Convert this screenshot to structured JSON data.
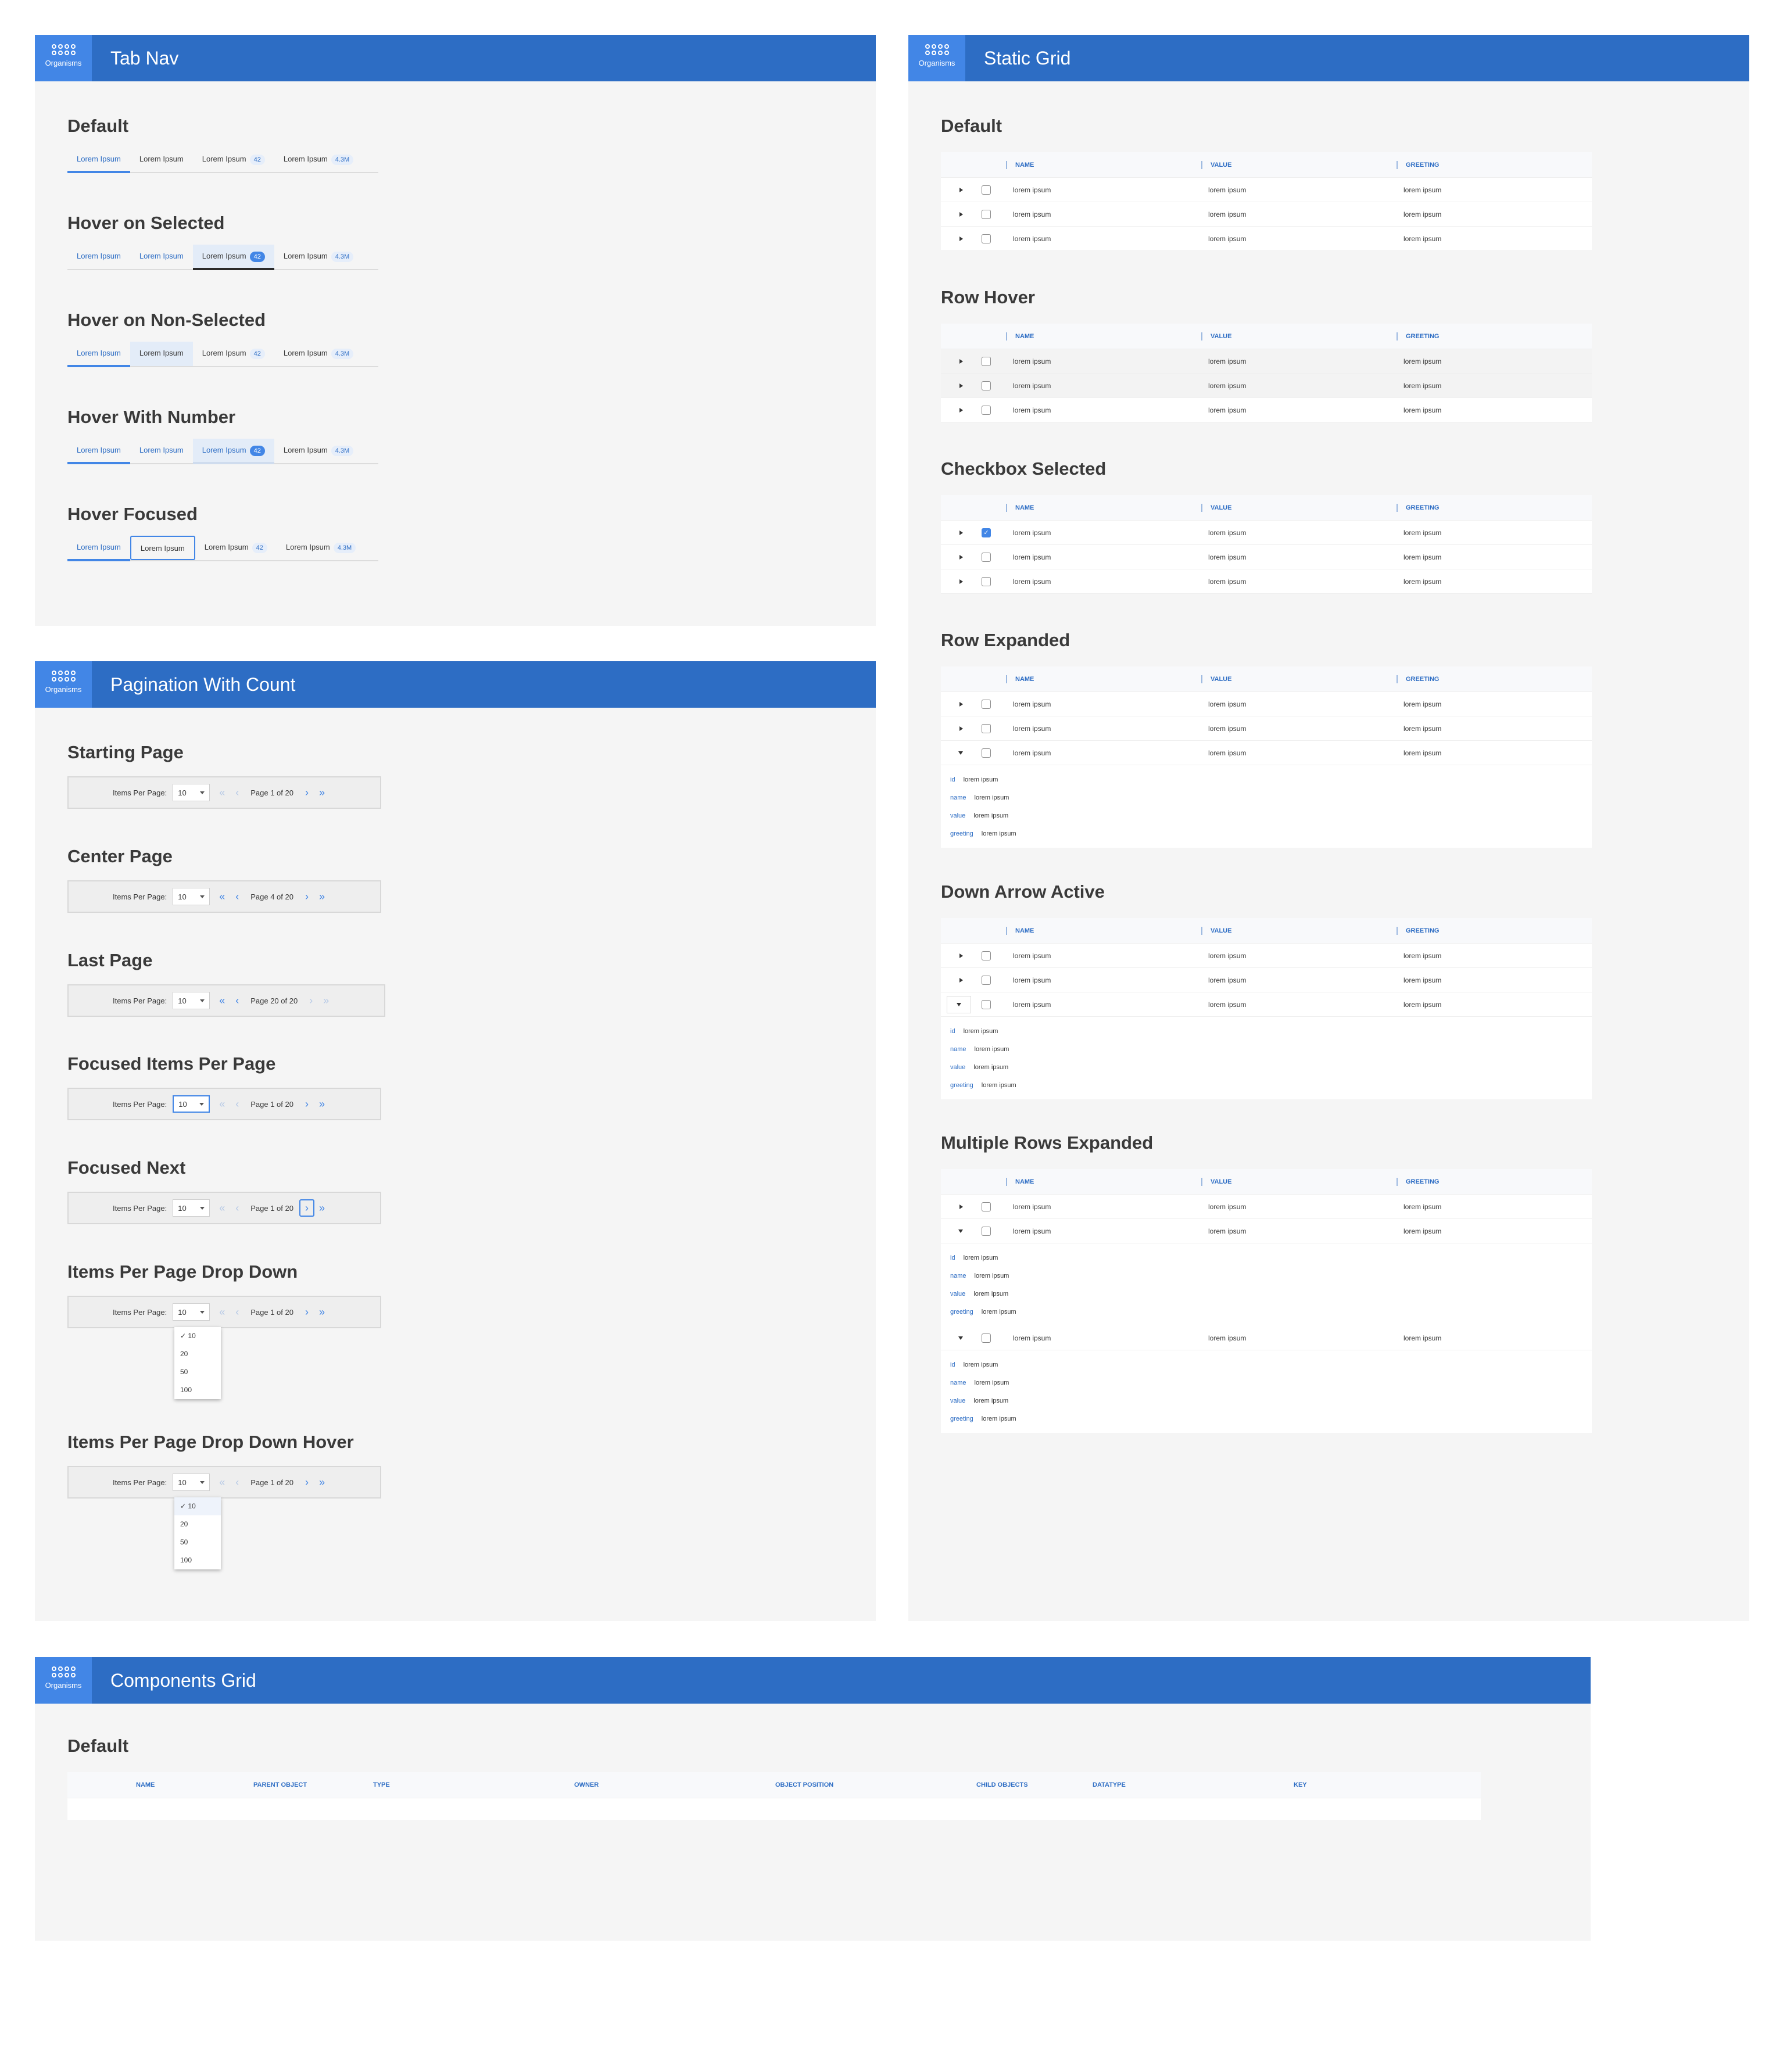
{
  "org_label": "Organisms",
  "tabnav": {
    "title": "Tab Nav",
    "sections": [
      {
        "title": "Default",
        "tabs": [
          {
            "label": "Lorem Ipsum",
            "badge": ""
          },
          {
            "label": "Lorem Ipsum",
            "badge": ""
          },
          {
            "label": "Lorem Ipsum",
            "badge": "42"
          },
          {
            "label": "Lorem Ipsum",
            "badge": "4.3M"
          }
        ]
      },
      {
        "title": "Hover on Selected",
        "tabs": [
          {
            "label": "Lorem Ipsum",
            "badge": ""
          },
          {
            "label": "Lorem Ipsum",
            "badge": ""
          },
          {
            "label": "Lorem Ipsum",
            "badge": "42"
          },
          {
            "label": "Lorem Ipsum",
            "badge": "4.3M"
          }
        ]
      },
      {
        "title": "Hover on Non-Selected",
        "tabs": [
          {
            "label": "Lorem Ipsum",
            "badge": ""
          },
          {
            "label": "Lorem Ipsum",
            "badge": ""
          },
          {
            "label": "Lorem Ipsum",
            "badge": "42"
          },
          {
            "label": "Lorem Ipsum",
            "badge": "4.3M"
          }
        ]
      },
      {
        "title": "Hover With Number",
        "tabs": [
          {
            "label": "Lorem Ipsum",
            "badge": ""
          },
          {
            "label": "Lorem Ipsum",
            "badge": ""
          },
          {
            "label": "Lorem Ipsum",
            "badge": "42"
          },
          {
            "label": "Lorem Ipsum",
            "badge": "4.3M"
          }
        ]
      },
      {
        "title": "Hover Focused",
        "tabs": [
          {
            "label": "Lorem Ipsum",
            "badge": ""
          },
          {
            "label": "Lorem Ipsum",
            "badge": ""
          },
          {
            "label": "Lorem Ipsum",
            "badge": "42"
          },
          {
            "label": "Lorem Ipsum",
            "badge": "4.3M"
          }
        ]
      }
    ]
  },
  "pagination": {
    "title": "Pagination With Count",
    "items_label": "Items Per Page:",
    "items_value": "10",
    "options": [
      "10",
      "20",
      "50",
      "100"
    ],
    "sections": [
      {
        "title": "Starting Page",
        "page_text": "Page 1 of 20"
      },
      {
        "title": "Center Page",
        "page_text": "Page 4 of 20"
      },
      {
        "title": "Last Page",
        "page_text": "Page 20 of 20"
      },
      {
        "title": "Focused Items Per Page",
        "page_text": "Page 1 of 20"
      },
      {
        "title": "Focused Next",
        "page_text": "Page 1 of 20"
      },
      {
        "title": "Items Per Page Drop Down",
        "page_text": "Page 1 of 20"
      },
      {
        "title": "Items Per Page Drop Down Hover",
        "page_text": "Page 1 of 20"
      }
    ]
  },
  "static_grid": {
    "title": "Static Grid",
    "columns": [
      "NAME",
      "VALUE",
      "GREETING"
    ],
    "cell": "lorem ipsum",
    "detail_keys": [
      "id",
      "name",
      "value",
      "greeting"
    ],
    "sections": [
      {
        "title": "Default"
      },
      {
        "title": "Row Hover"
      },
      {
        "title": "Checkbox Selected"
      },
      {
        "title": "Row Expanded"
      },
      {
        "title": "Down Arrow Active"
      },
      {
        "title": "Multiple Rows Expanded"
      }
    ]
  },
  "components_grid": {
    "title": "Components Grid",
    "section_title": "Default",
    "columns": [
      "NAME",
      "PARENT OBJECT",
      "TYPE",
      "OWNER",
      "OBJECT POSITION",
      "CHILD OBJECTS",
      "DATATYPE",
      "KEY"
    ]
  }
}
